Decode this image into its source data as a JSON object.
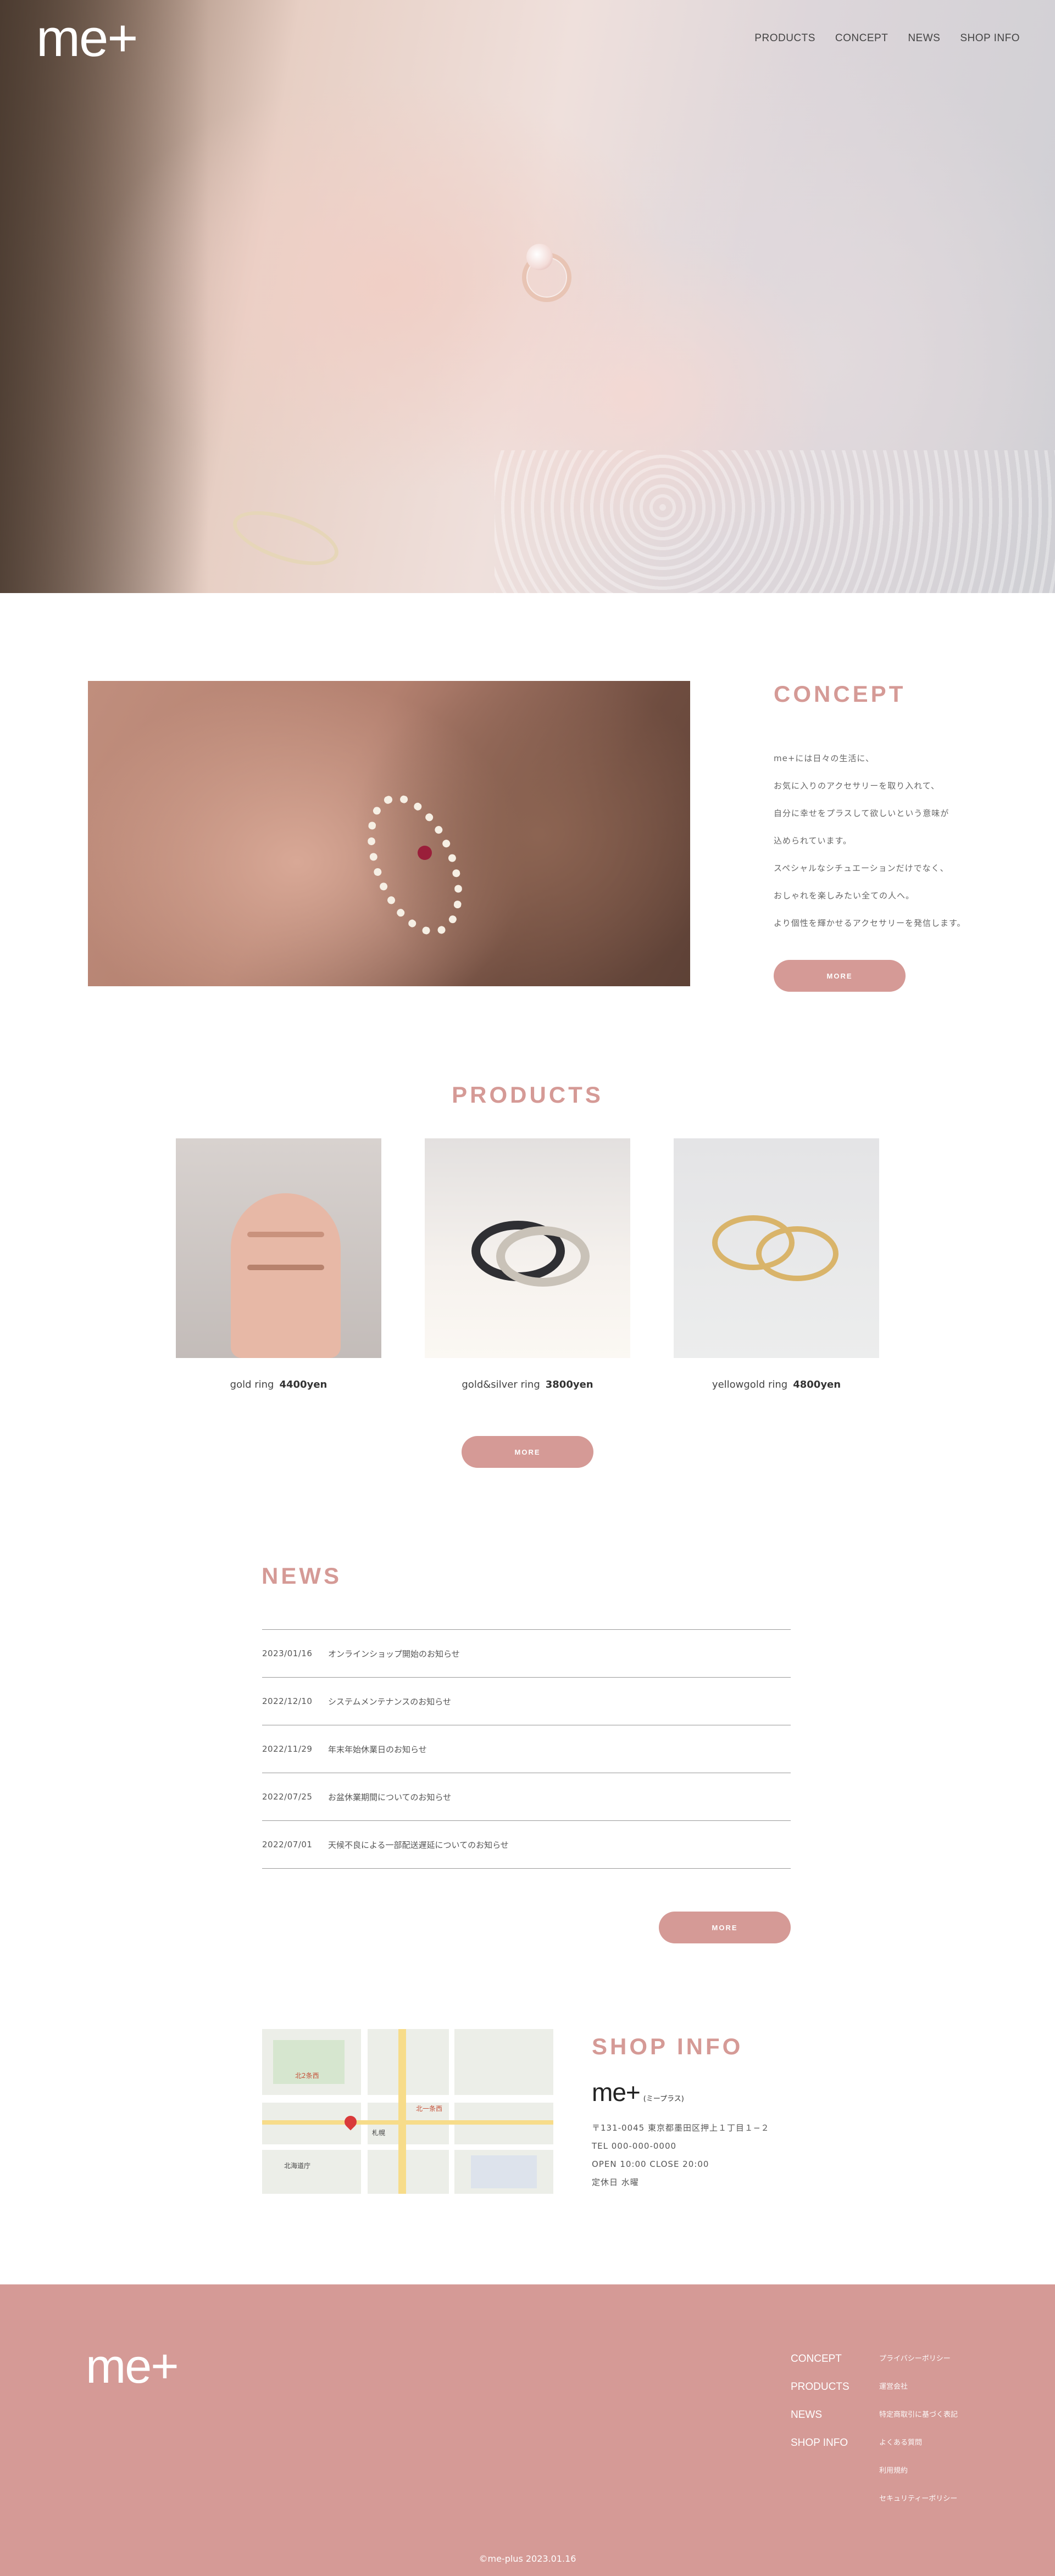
{
  "header": {
    "logo": "me+",
    "nav": [
      "PRODUCTS",
      "CONCEPT",
      "NEWS",
      "SHOP INFO"
    ]
  },
  "concept": {
    "title": "CONCEPT",
    "lines": [
      "me+には日々の生活に、",
      "お気に入りのアクセサリーを取り入れて、",
      "自分に幸せをプラスして欲しいという意味が",
      "込められています。",
      "スペシャルなシチュエーションだけでなく、",
      "おしゃれを楽しみたい全ての人へ。",
      "より個性を輝かせるアクセサリーを発信します。"
    ],
    "more": "MORE"
  },
  "products": {
    "title": "PRODUCTS",
    "items": [
      {
        "name": "gold ring",
        "price": "4400yen"
      },
      {
        "name": "gold&silver ring",
        "price": "3800yen"
      },
      {
        "name": "yellowgold ring",
        "price": "4800yen"
      }
    ],
    "more": "MORE"
  },
  "news": {
    "title": "NEWS",
    "items": [
      {
        "date": "2023/01/16",
        "text": "オンラインショップ開始のお知らせ"
      },
      {
        "date": "2022/12/10",
        "text": "システムメンテナンスのお知らせ"
      },
      {
        "date": "2022/11/29",
        "text": "年末年始休業日のお知らせ"
      },
      {
        "date": "2022/07/25",
        "text": "お盆休業期間についてのお知らせ"
      },
      {
        "date": "2022/07/01",
        "text": "天候不良による一部配送遅延についてのお知らせ"
      }
    ],
    "more": "MORE"
  },
  "shop": {
    "title": "SHOP INFO",
    "name": "me+",
    "name_reading": "(ミープラス)",
    "lines": [
      "〒131-0045 東京都墨田区押上１丁目１−２",
      "TEL 000-000-0000",
      "OPEN  10:00  CLOSE 20:00",
      "定休日 水曜"
    ],
    "map_labels": [
      "北2条西",
      "北一条西",
      "札幌",
      "北海道庁"
    ]
  },
  "footer": {
    "logo": "me+",
    "nav": [
      "CONCEPT",
      "PRODUCTS",
      "NEWS",
      "SHOP INFO"
    ],
    "links": [
      "プライバシーポリシー",
      "運営会社",
      "特定商取引に基づく表記",
      "よくある質問",
      "利用規約",
      "セキュリティーポリシー"
    ],
    "copyright": "©me-plus 2023.01.16"
  },
  "colors": {
    "accent": "#d59a96",
    "footer_bg": "#d59a96"
  }
}
